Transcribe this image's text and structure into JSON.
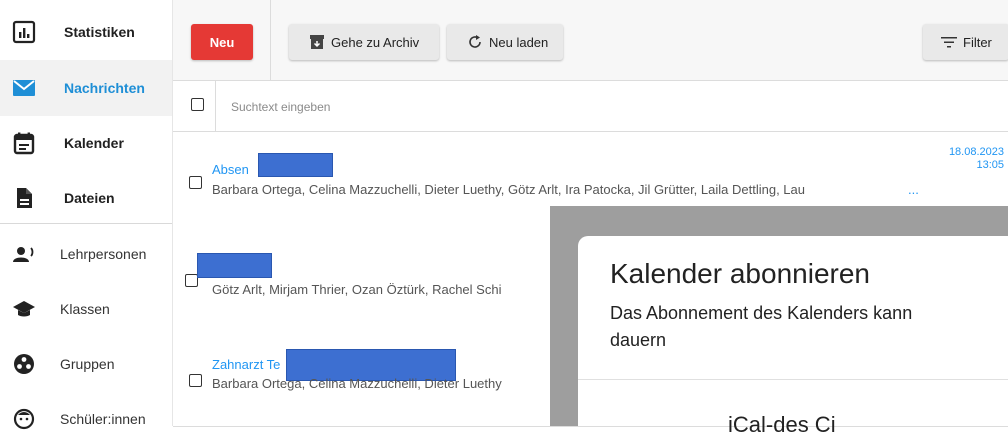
{
  "sidebar": {
    "items": [
      {
        "label": "Statistiken",
        "icon": "chart-icon"
      },
      {
        "label": "Nachrichten",
        "icon": "mail-icon",
        "active": true
      },
      {
        "label": "Kalender",
        "icon": "calendar-icon"
      },
      {
        "label": "Dateien",
        "icon": "file-icon"
      },
      {
        "label": "Lehrpersonen",
        "icon": "teacher-icon"
      },
      {
        "label": "Klassen",
        "icon": "graduation-cap-icon"
      },
      {
        "label": "Gruppen",
        "icon": "group-icon"
      },
      {
        "label": "Schüler:innen",
        "icon": "student-icon"
      }
    ]
  },
  "toolbar": {
    "new_label": "Neu",
    "archive_label": "Gehe zu Archiv",
    "reload_label": "Neu laden",
    "filter_label": "Filter"
  },
  "search": {
    "placeholder": "Suchtext eingeben"
  },
  "messages": [
    {
      "subject": "Absen",
      "recipients": "Barbara Ortega, Celina Mazzuchelli, Dieter Luethy, Götz Arlt, Ira Patocka, Jil Grütter, Laila Dettling, Lau",
      "more": "...",
      "date": "18.08.2023",
      "time": "13:05"
    },
    {
      "subject": "",
      "recipients": "Götz Arlt, Mirjam Thrier, Ozan Öztürk, Rachel Schi"
    },
    {
      "subject": "Zahnarzt Te",
      "recipients": "Barbara Ortega, Celina Mazzuchelli, Dieter Luethy"
    }
  ],
  "modal": {
    "title": "Kalender abonnieren",
    "body_line1": "Das Abonnement des Kalenders kann",
    "body_line2": "dauern",
    "partial_text": "iCal-des Ci"
  },
  "colors": {
    "accent": "#2196f3",
    "new_button": "#e53935",
    "redaction": "#3d6fd1"
  }
}
